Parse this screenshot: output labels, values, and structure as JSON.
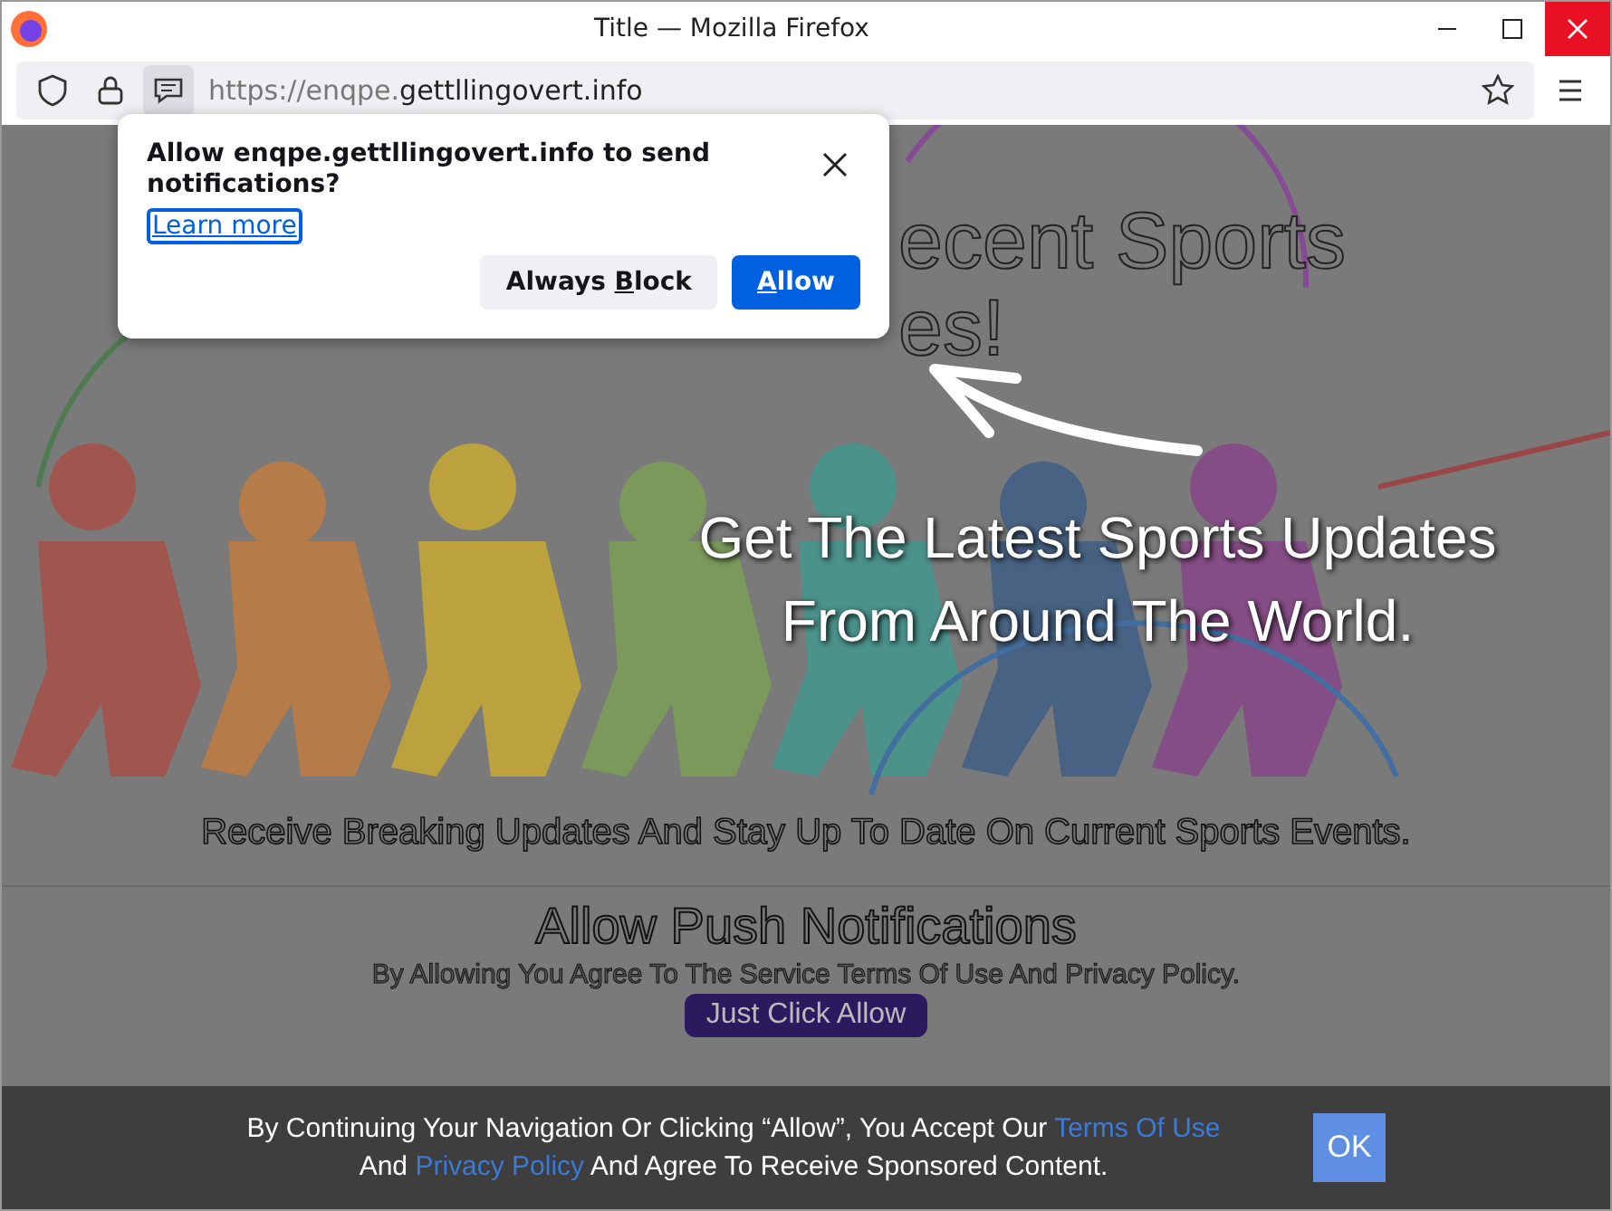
{
  "window": {
    "title": "Title — Mozilla Firefox"
  },
  "toolbar": {
    "url_prefix": "https://enqpe.",
    "url_domain": "gettllingovert.info"
  },
  "permission_popup": {
    "message": "Allow enqpe.gettllingovert.info to send notifications?",
    "link": "Learn more",
    "buttons": [
      {
        "label_before": "Always ",
        "access_key": "B",
        "label_after": "lock",
        "primary": false
      },
      {
        "access_key": "A",
        "label_after": "llow",
        "primary": true
      }
    ]
  },
  "hero": {
    "heading_fragments": [
      "ecent Sports",
      "es!"
    ],
    "tagline": [
      "Get The Latest Sports Updates",
      "From Around The World."
    ],
    "subtitle": "Receive Breaking Updates And Stay Up To Date On Current Sports Events."
  },
  "push_section": {
    "title": "Allow Push Notifications",
    "note": "By Allowing You Agree To The Service Terms Of Use And Privacy Policy.",
    "button": "Just Click Allow"
  },
  "consent_bar": {
    "text_before": "By Continuing Your Navigation Or Clicking “Allow”, You Accept Our",
    "link_terms": "Terms Of Use",
    "text_and": "And",
    "link_privacy": "Privacy Policy",
    "text_after": "And Agree To Receive Sponsored Content.",
    "button": "OK"
  }
}
